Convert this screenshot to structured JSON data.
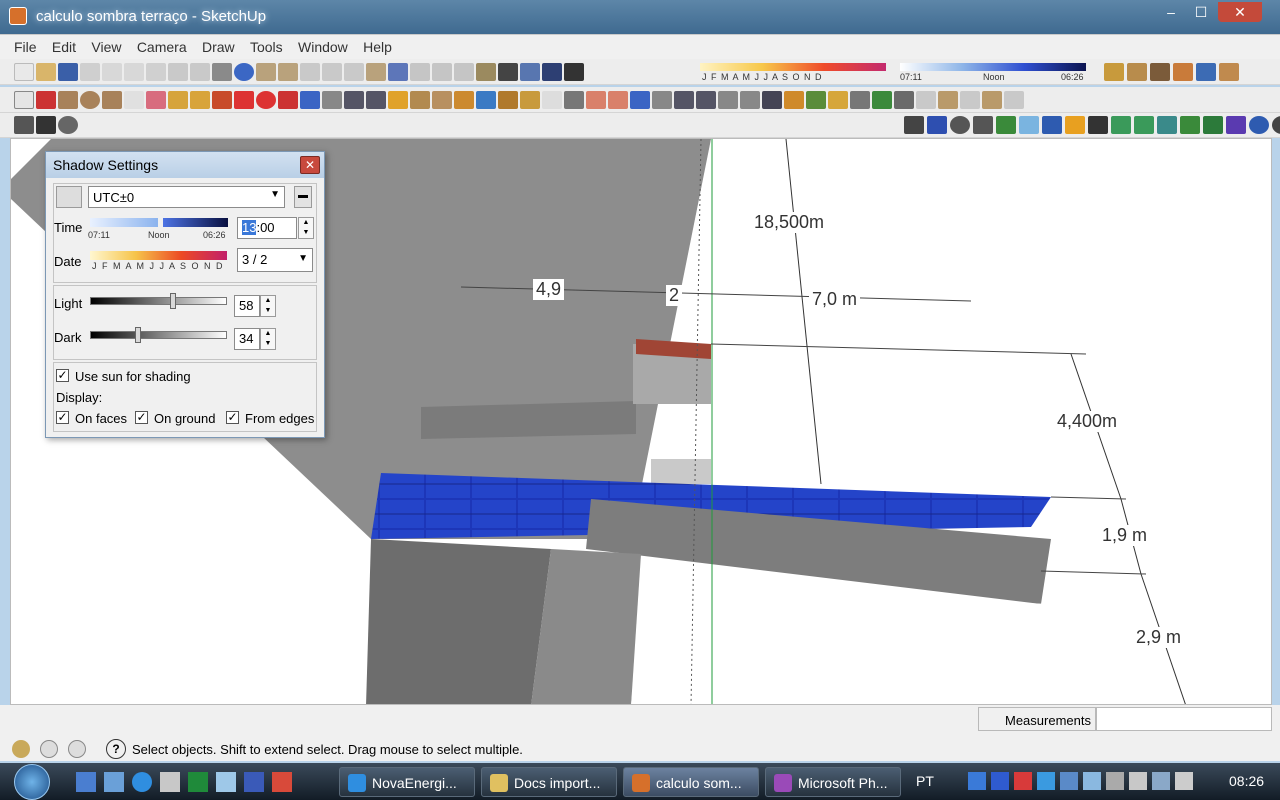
{
  "window": {
    "title": "calculo sombra terraço - SketchUp",
    "min": "–",
    "max": "☐",
    "close": "✕"
  },
  "menu": [
    "File",
    "Edit",
    "View",
    "Camera",
    "Draw",
    "Tools",
    "Window",
    "Help"
  ],
  "toolbar_shadow": {
    "months": "J F M A M J J A S O N D",
    "time_start": "07:11",
    "time_noon": "Noon",
    "time_end": "06:26"
  },
  "dimensions": {
    "d1": "18,500m",
    "d2": "4,9",
    "d3": "2",
    "d4": "7,0 m",
    "d5": "4,400m",
    "d6": "1,9 m",
    "d7": "2,9 m"
  },
  "shadow": {
    "title": "Shadow Settings",
    "close": "✕",
    "timezone": "UTC±0",
    "time_label": "Time",
    "time_start": "07:11",
    "time_noon": "Noon",
    "time_end": "06:26",
    "time_value": "13:00",
    "time_hour": "13",
    "time_rest": ":00",
    "date_label": "Date",
    "date_months": "J F M A M J J A S O N D",
    "date_value": "3 / 2",
    "light_label": "Light",
    "light_value": "58",
    "dark_label": "Dark",
    "dark_value": "34",
    "use_sun": "Use sun for shading",
    "display_label": "Display:",
    "on_faces": "On faces",
    "on_ground": "On ground",
    "from_edges": "From edges"
  },
  "status": {
    "text": "Select objects. Shift to extend select. Drag mouse to select multiple.",
    "measurements": "Measurements",
    "help": "?"
  },
  "taskbar": {
    "items": [
      "NovaEnergi...",
      "Docs import...",
      "calculo som...",
      "Microsoft Ph..."
    ],
    "lang": "PT",
    "clock": "08:26"
  }
}
